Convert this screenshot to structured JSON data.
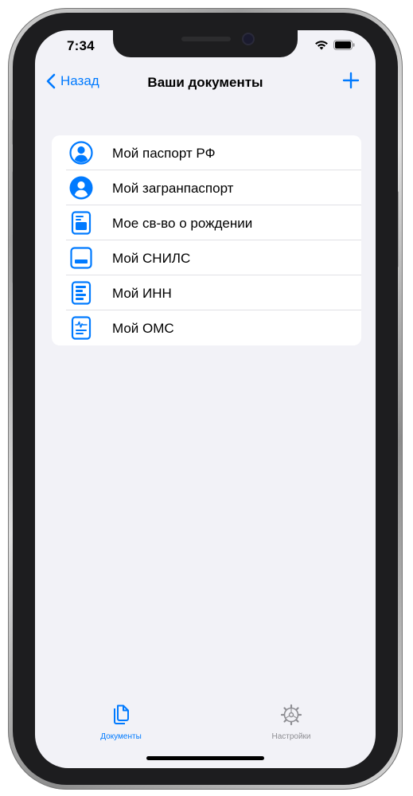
{
  "status_bar": {
    "time": "7:34",
    "icons": [
      "wifi-icon",
      "battery-icon"
    ]
  },
  "nav": {
    "back_label": "Назад",
    "title": "Ваши документы",
    "add_icon": "plus-icon"
  },
  "documents": [
    {
      "label": "Мой паспорт РФ",
      "icon": "person-circle-outline-icon"
    },
    {
      "label": "Мой загранпаспорт",
      "icon": "person-circle-filled-icon"
    },
    {
      "label": "Мое св-во о рождении",
      "icon": "birth-certificate-icon"
    },
    {
      "label": "Мой СНИЛС",
      "icon": "snils-card-icon"
    },
    {
      "label": "Мой ИНН",
      "icon": "inn-document-icon"
    },
    {
      "label": "Мой ОМС",
      "icon": "medical-document-icon"
    }
  ],
  "tabbar": {
    "tabs": [
      {
        "label": "Документы",
        "icon": "documents-icon",
        "active": true
      },
      {
        "label": "Настройки",
        "icon": "gear-icon",
        "active": false
      }
    ]
  },
  "colors": {
    "accent": "#007aff",
    "background": "#f2f2f7",
    "inactive": "#8e8e93"
  }
}
